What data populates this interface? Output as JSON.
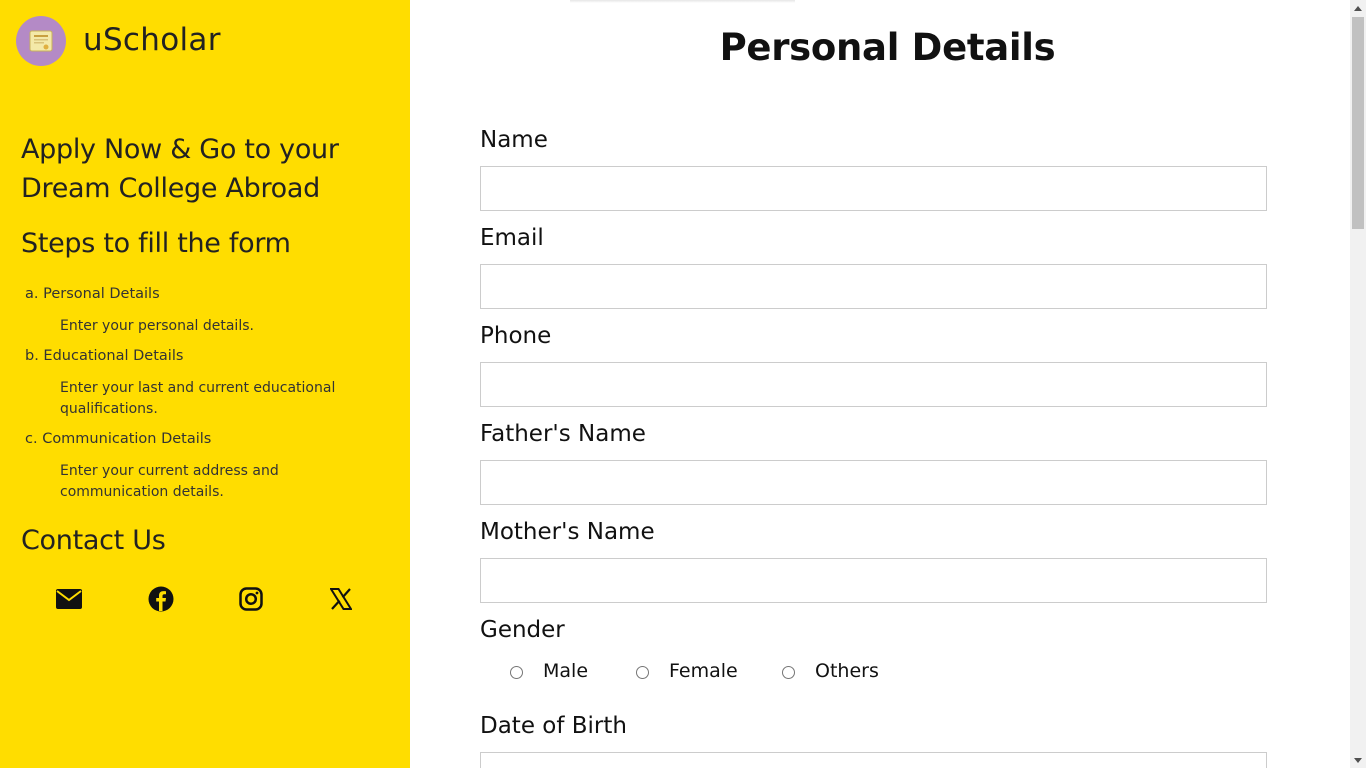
{
  "brand": {
    "name": "uScholar"
  },
  "sidebar": {
    "headline": "Apply  Now & Go to your Dream College Abroad",
    "steps_title": "Steps to fill the form",
    "steps": [
      {
        "label": "a. Personal Details",
        "desc": "Enter your personal details."
      },
      {
        "label": "b. Educational Details",
        "desc": "Enter your last and current educational qualifications."
      },
      {
        "label": "c. Communication Details",
        "desc": "Enter your current address and communication details."
      }
    ],
    "contact_title": "Contact Us",
    "social_icons": [
      "envelope-icon",
      "facebook-icon",
      "instagram-icon",
      "x-twitter-icon"
    ]
  },
  "form": {
    "title": "Personal Details",
    "fields": [
      {
        "label": "Name",
        "value": "",
        "placeholder": ""
      },
      {
        "label": "Email",
        "value": "",
        "placeholder": ""
      },
      {
        "label": "Phone",
        "value": "",
        "placeholder": ""
      },
      {
        "label": "Father's Name",
        "value": "",
        "placeholder": ""
      },
      {
        "label": "Mother's Name",
        "value": "",
        "placeholder": ""
      }
    ],
    "gender": {
      "label": "Gender",
      "options": [
        "Male",
        "Female",
        "Others"
      ]
    },
    "dob": {
      "label": "Date of Birth"
    }
  },
  "colors": {
    "sidebar_bg": "#ffdd00",
    "logo_bg": "#b48ac6",
    "field_border": "#cccccc"
  }
}
